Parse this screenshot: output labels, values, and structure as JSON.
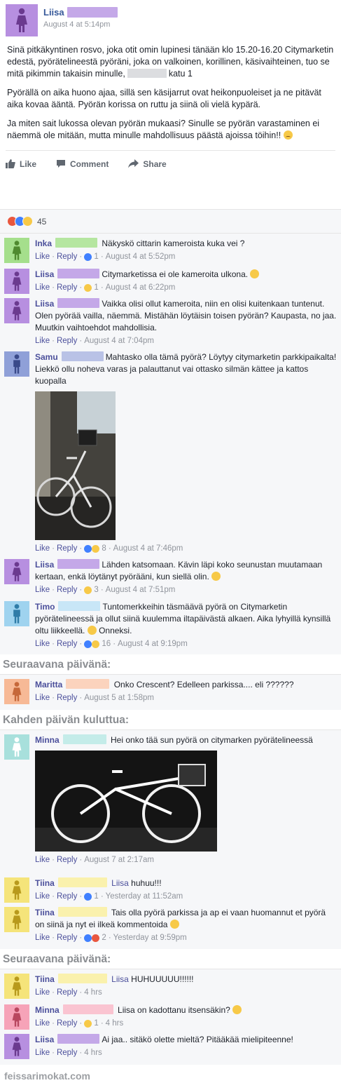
{
  "post": {
    "author": "Liisa",
    "author_redact_color": "#c4a8e8",
    "time": "August 4 at 5:14pm",
    "paragraph1_a": "Sinä pitkäkyntinen rosvo, joka otit omin lupinesi tänään klo 15.20-16.20 Citymarketin edestä, pyörätelineestä pyöräni, joka on valkoinen, korillinen, käsivaihteinen, tuo se mitä pikimmin takaisin minulle,",
    "paragraph1_b": "katu 1",
    "paragraph2": "Pyörällä on aika huono ajaa, sillä sen käsijarrut ovat heikonpuoleiset ja ne pitävät aika kovaa ääntä. Pyörän korissa on ruttu ja siinä oli vielä kypärä.",
    "paragraph3": "Ja miten sait lukossa olevan pyörän mukaasi? Sinulle se pyörän varastaminen ei näemmä ole mitään, mutta minulle mahdollisuus päästä ajoissa töihin!!"
  },
  "actions": {
    "like": "Like",
    "comment": "Comment",
    "share": "Share"
  },
  "reactions": {
    "count": "45"
  },
  "links": {
    "like": "Like",
    "reply": "Reply"
  },
  "c1": {
    "name": "Inka",
    "text": "Näkyskö cittarin kameroista kuka vei ?",
    "count": "1",
    "time": "August 4 at 5:52pm"
  },
  "c2": {
    "name": "Liisa",
    "text": "Citymarketissa ei ole kameroita ulkona.",
    "count": "1",
    "time": "August 4 at 6:22pm"
  },
  "c3": {
    "name": "Liisa",
    "text": "Vaikka olisi ollut kameroita, niin en olisi kuitenkaan tuntenut. Olen pyörää vailla, näemmä. Mistähän löytäisin toisen pyörän? Kaupasta, no jaa. Muutkin vaihtoehdot mahdollisia.",
    "time": "August 4 at 7:04pm"
  },
  "c4": {
    "name": "Samu",
    "text": "Mahtasko olla tämä pyörä? Löytyy citymarketin parkkipaikalta! Liekkö ollu noheva varas ja palauttanut vai ottasko silmän kättee ja kattos kuopalla",
    "count": "8",
    "time": "August 4 at 7:46pm"
  },
  "c5": {
    "name": "Liisa",
    "text": "Lähden katsomaan. Kävin läpi koko seunustan muutamaan kertaan, enkä löytänyt pyörääni, kun siellä olin.",
    "count": "3",
    "time": "August 4 at 7:51pm"
  },
  "c6": {
    "name": "Timo",
    "text": "Tuntomerkkeihin täsmäävä pyörä on Citymarketin pyörätelineessä ja ollut siinä kuulemma iltapäivästä alkaen. Aika lyhyillä kynsillä oltu liikkeellä.",
    "text2": "Onneksi.",
    "count": "16",
    "time": "August 4 at 9:19pm"
  },
  "section1": "Seuraavana päivänä:",
  "c7": {
    "name": "Maritta",
    "text": "Onko Crescent? Edelleen parkissa.... eli ??????",
    "time": "August 5 at 1:58pm"
  },
  "section2": "Kahden päivän kuluttua:",
  "c8": {
    "name": "Minna",
    "text": "Hei onko tää sun pyörä on citymarken pyörätelineessä",
    "time": "August 7 at 2:17am"
  },
  "c9": {
    "name": "Tiina",
    "mention": "Liisa",
    "text": "huhuu!!!",
    "count": "1",
    "time": "Yesterday at 11:52am"
  },
  "c10": {
    "name": "Tiina",
    "text": "Tais olla pyörä parkissa ja ap ei vaan huomannut et pyörä on siinä ja nyt ei ilkeä kommentoida",
    "count": "2",
    "time": "Yesterday at 9:59pm"
  },
  "section3": "Seuraavana päivänä:",
  "c11": {
    "name": "Tiina",
    "mention": "Liisa",
    "text": "HUHUUUUU!!!!!!",
    "time": "4 hrs"
  },
  "c12": {
    "name": "Minna",
    "text": "Liisa on kadottanu itsensäkin?",
    "count": "1",
    "time": "4 hrs"
  },
  "c13": {
    "name": "Liisa",
    "text": "Ai jaa.. sitäkö olette mieltä? Pitääkää mielipiteenne!",
    "time": "4 hrs"
  },
  "footer": "feissarimokat.com",
  "colors": {
    "purple": "#b78fe0",
    "green": "#a5df8c",
    "blue": "#8fa0d8",
    "lightblue": "#9fd3ef",
    "peach": "#f7b996",
    "teal": "#a8e0dc",
    "yellow": "#f5e47a",
    "pink": "#f6a3b8",
    "like_blue": "#4080ff",
    "link": "#4b4f9b"
  }
}
